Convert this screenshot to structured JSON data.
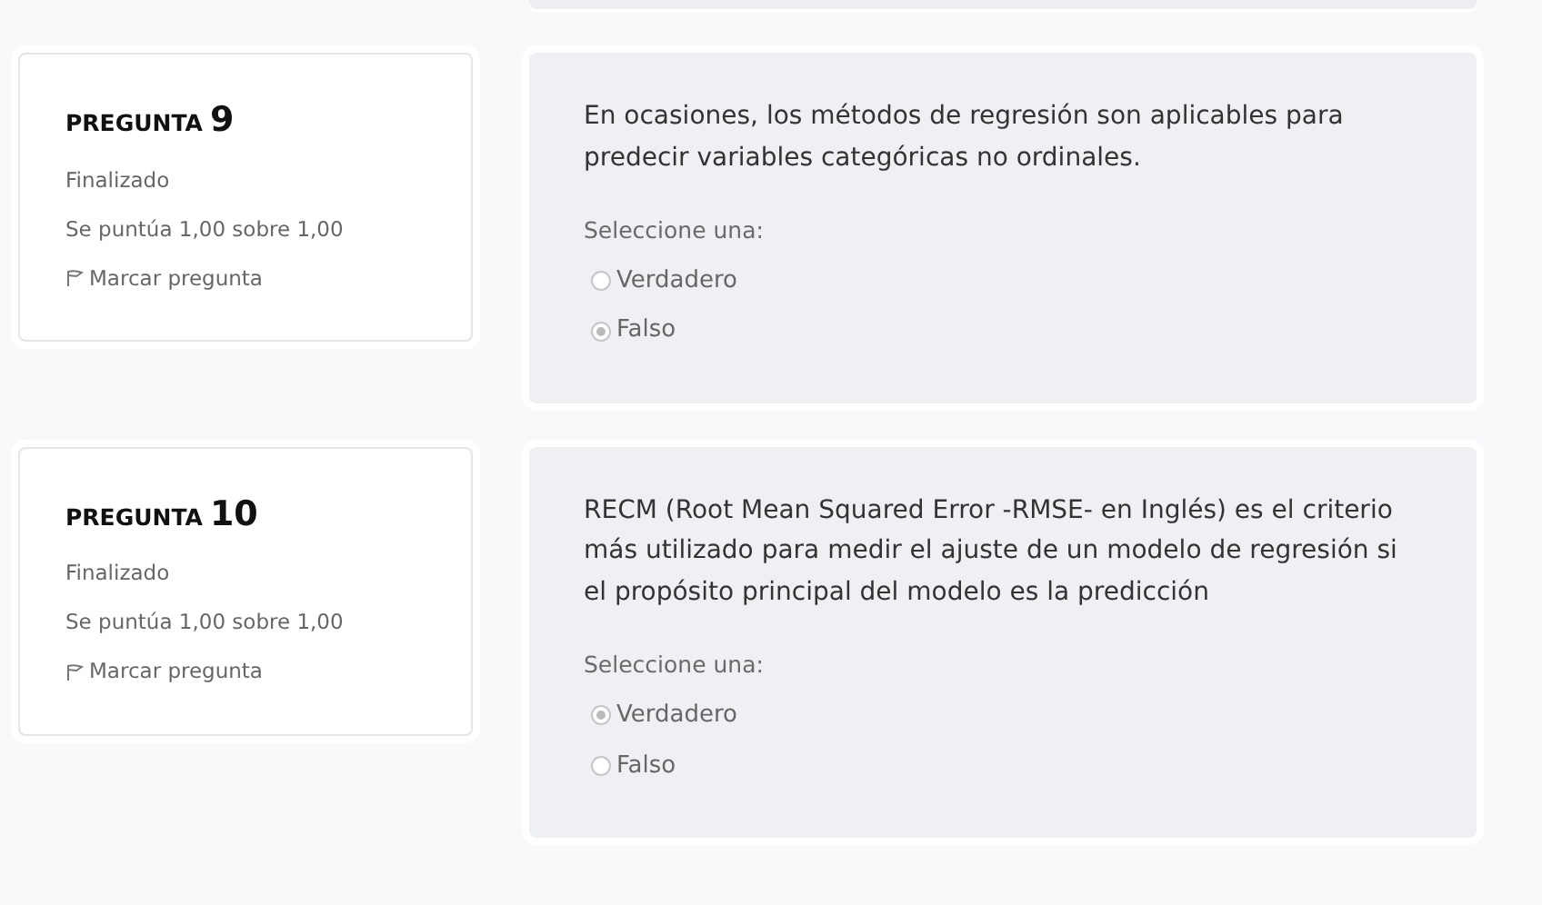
{
  "questions": [
    {
      "label": "PREGUNTA",
      "number": "9",
      "status": "Finalizado",
      "grade": "Se puntúa 1,00 sobre 1,00",
      "flag_link": "Marcar pregunta",
      "text": "En ocasiones, los métodos de regresión son aplicables para predecir variables categóricas no ordinales.",
      "prompt": "Seleccione una:",
      "options": [
        {
          "label": "Verdadero",
          "selected": false
        },
        {
          "label": "Falso",
          "selected": true
        }
      ]
    },
    {
      "label": "PREGUNTA",
      "number": "10",
      "status": "Finalizado",
      "grade": "Se puntúa 1,00 sobre 1,00",
      "flag_link": "Marcar pregunta",
      "text": "RECM (Root Mean Squared Error -RMSE- en Inglés) es el criterio más utilizado para medir el ajuste de un modelo de regresión si el propósito principal del modelo es la predicción",
      "prompt": "Seleccione una:",
      "options": [
        {
          "label": "Verdadero",
          "selected": true
        },
        {
          "label": "Falso",
          "selected": false
        }
      ]
    }
  ]
}
